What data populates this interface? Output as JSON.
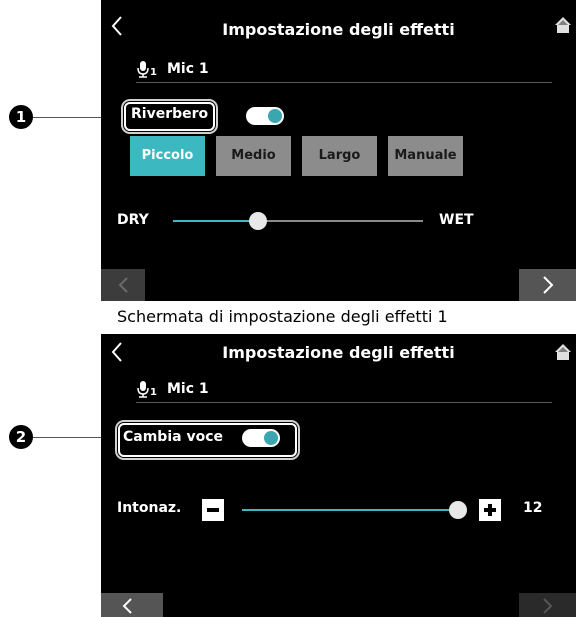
{
  "screen1": {
    "title": "Impostazione degli effetti",
    "mic_sub": "1",
    "mic_name": "Mic 1",
    "effect_label": "Riverbero",
    "effect_on": true,
    "presets": [
      "Piccolo",
      "Medio",
      "Largo",
      "Manuale"
    ],
    "active_preset": "Piccolo",
    "slider_left_label": "DRY",
    "slider_right_label": "WET",
    "slider_fraction": 0.34
  },
  "caption": "Schermata di impostazione degli effetti 1",
  "screen2": {
    "title": "Impostazione degli effetti",
    "mic_sub": "1",
    "mic_name": "Mic 1",
    "effect_label": "Cambia voce",
    "effect_on": true,
    "pitch_label": "Intonaz.",
    "pitch_value": "12",
    "pitch_fraction": 1.0
  },
  "callouts": [
    "1",
    "2"
  ],
  "colors": {
    "accent": "#3cb8c0",
    "inactive": "#8c8c8c",
    "background": "#000000"
  }
}
